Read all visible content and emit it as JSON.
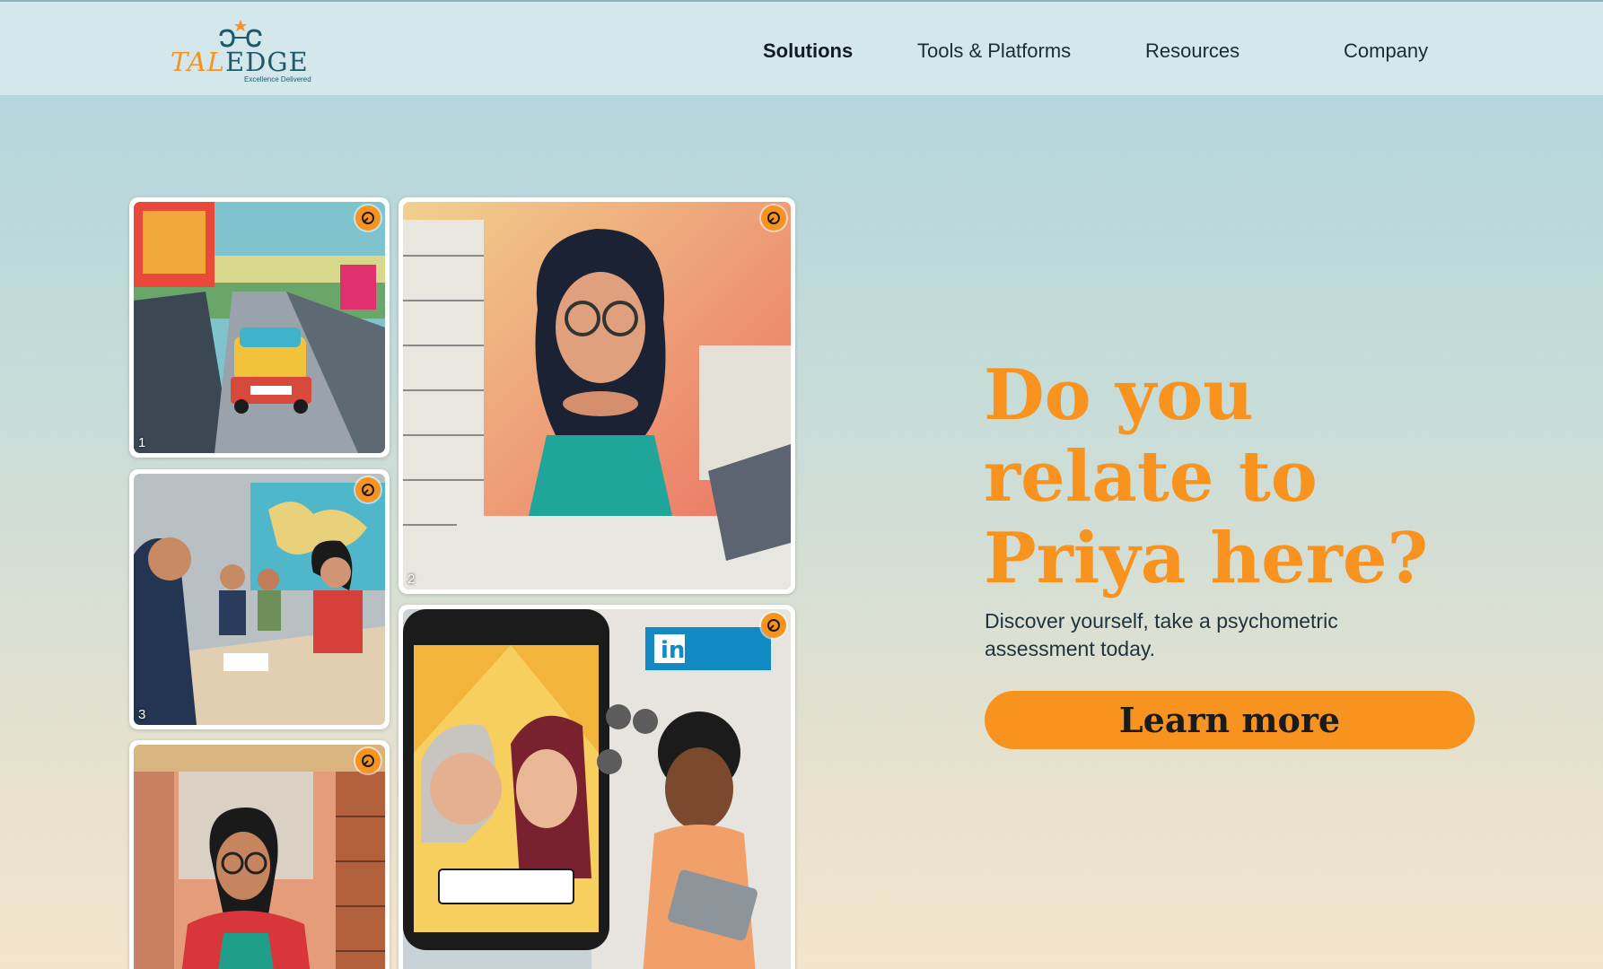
{
  "brand": {
    "name_part1": "TAL",
    "name_part2": "EDGE",
    "tagline": "Excellence Delivered"
  },
  "nav": {
    "items": [
      {
        "label": "Solutions",
        "active": true
      },
      {
        "label": "Tools & Platforms",
        "active": false
      },
      {
        "label": "Resources",
        "active": false
      },
      {
        "label": "Company",
        "active": false
      }
    ]
  },
  "gallery": {
    "tiles": [
      {
        "number": "1",
        "subject": "street-traffic",
        "badge_icon": "hand-icon"
      },
      {
        "number": "2",
        "subject": "woman-with-paperwork",
        "badge_icon": "hand-icon"
      },
      {
        "number": "3",
        "subject": "meeting-room",
        "badge_icon": "hand-icon"
      },
      {
        "number": "",
        "subject": "linkedin-phone",
        "badge_icon": "hand-icon"
      },
      {
        "number": "",
        "subject": "woman-in-library",
        "badge_icon": "hand-icon"
      }
    ]
  },
  "hero": {
    "headline": "Do you relate to Priya here?",
    "subtext": "Discover yourself, take a psychometric assessment today.",
    "cta_label": "Learn more"
  },
  "colors": {
    "accent": "#f7931e",
    "brand_dark": "#1f5a68",
    "header_bg": "#d3e7ed"
  }
}
